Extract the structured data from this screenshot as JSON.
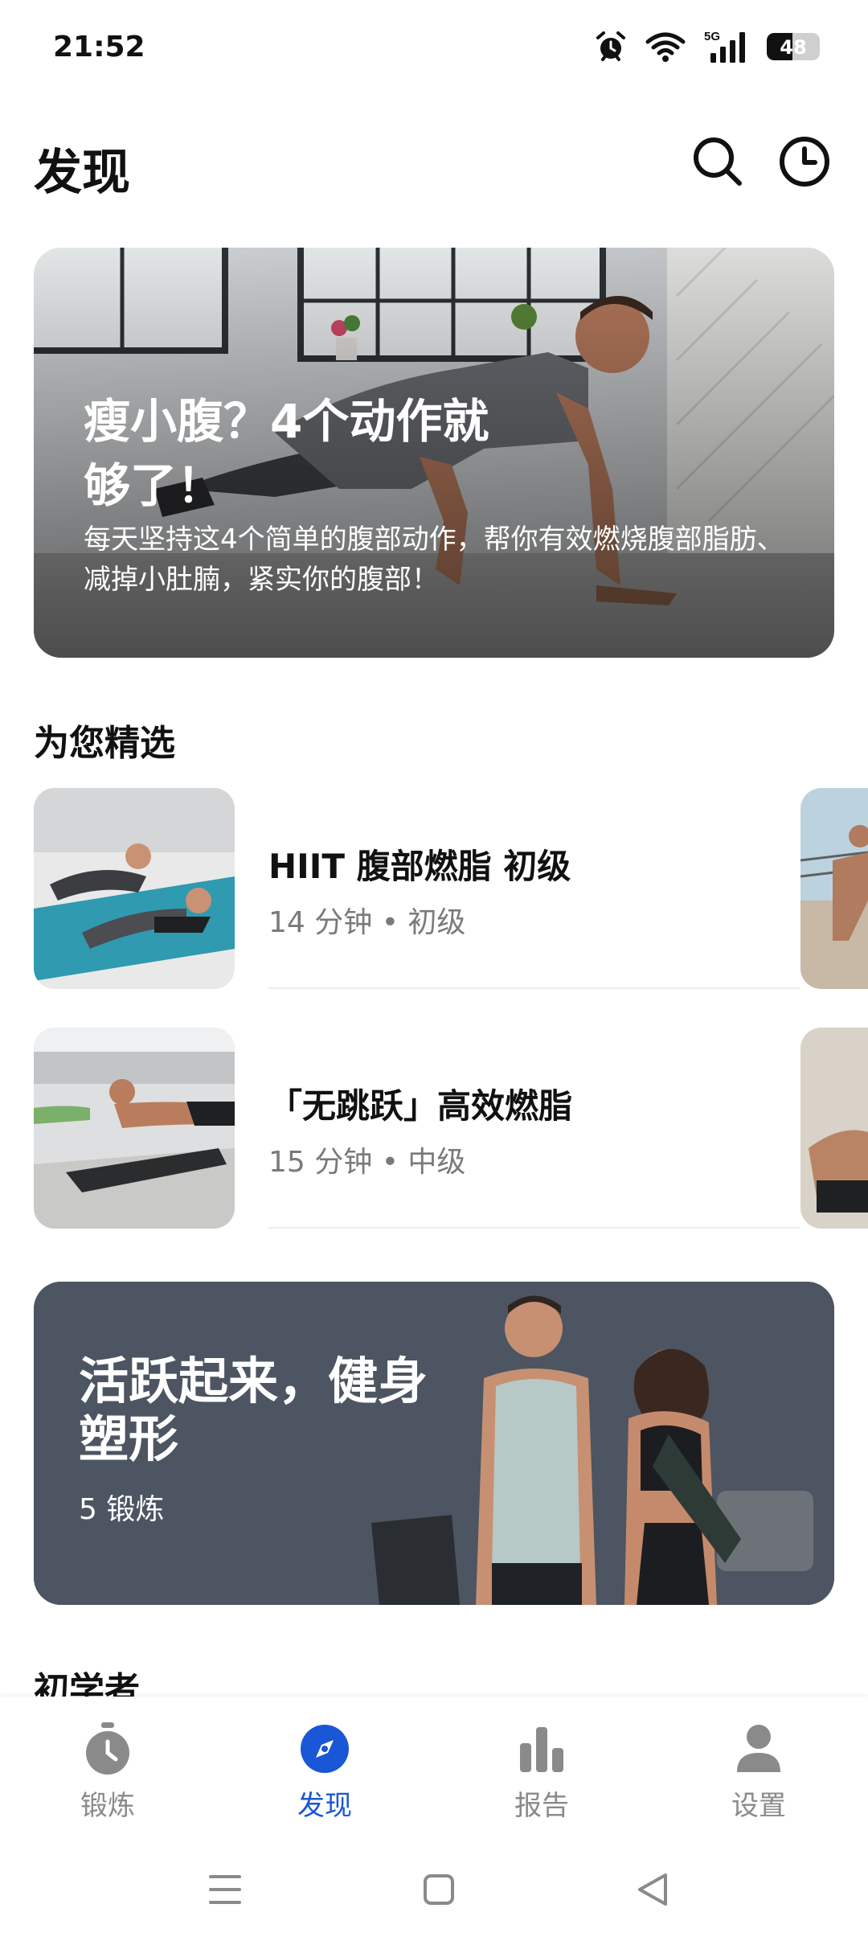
{
  "status": {
    "time": "21:52",
    "battery": "48",
    "battery_level": 0.48,
    "network": "5G"
  },
  "header": {
    "title": "发现",
    "icons": [
      "search-icon",
      "history-clock-icon"
    ]
  },
  "hero": {
    "title": "瘦小腹？4个动作就够了！",
    "description": "每天坚持这4个简单的腹部动作，帮你有效燃烧腹部脂肪、减掉小肚腩，紧实你的腹部！"
  },
  "featured": {
    "title": "为您精选",
    "items": [
      {
        "title": "HIIT 腹部燃脂 初级",
        "meta": "14 分钟 • 初级"
      },
      {
        "title": "「无跳跃」高效燃脂",
        "meta": "15 分钟 • 中级"
      }
    ]
  },
  "collection": {
    "title": "活跃起来，健身塑形",
    "count": "5 锻炼"
  },
  "beginner": {
    "title": "初学者"
  },
  "nav": {
    "items": [
      {
        "label": "锻炼",
        "icon": "stopwatch-icon"
      },
      {
        "label": "发现",
        "icon": "compass-icon",
        "active": true
      },
      {
        "label": "报告",
        "icon": "bar-chart-icon"
      },
      {
        "label": "设置",
        "icon": "person-icon"
      }
    ]
  },
  "colors": {
    "accent": "#1a57d6",
    "text": "#111111",
    "muted": "#7a7a7a",
    "inactive": "#8a8a8a"
  }
}
